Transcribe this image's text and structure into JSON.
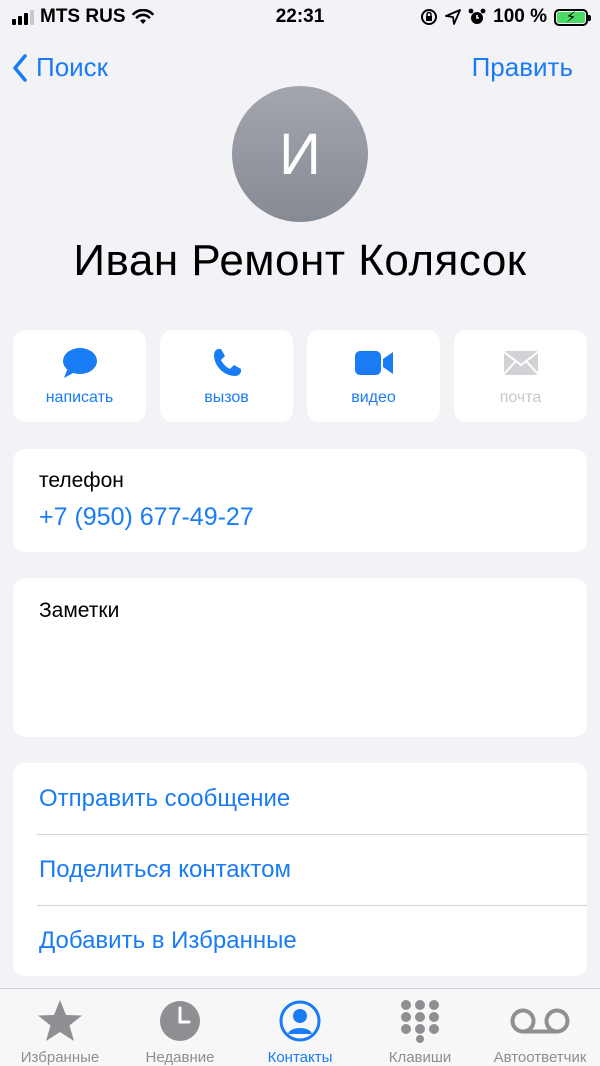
{
  "status_bar": {
    "carrier": "MTS RUS",
    "time": "22:31",
    "battery": "100 %",
    "battery_level": 1.0,
    "signal_bars": 4,
    "signal_bars_active": 3
  },
  "nav": {
    "back_label": "Поиск",
    "edit_label": "Править"
  },
  "contact": {
    "initial": "И",
    "name": "Иван Ремонт Колясок"
  },
  "actions": [
    {
      "label": "написать",
      "icon": "message-icon",
      "enabled": true
    },
    {
      "label": "вызов",
      "icon": "phone-icon",
      "enabled": true
    },
    {
      "label": "видео",
      "icon": "video-icon",
      "enabled": true
    },
    {
      "label": "почта",
      "icon": "mail-icon",
      "enabled": false
    }
  ],
  "phone": {
    "label": "телефон",
    "value": "+7 (950) 677-49-27"
  },
  "notes": {
    "label": "Заметки"
  },
  "links": [
    {
      "label": "Отправить сообщение"
    },
    {
      "label": "Поделиться контактом"
    },
    {
      "label": "Добавить в Избранные"
    }
  ],
  "tabbar": [
    {
      "label": "Избранные",
      "icon": "star-icon",
      "active": false
    },
    {
      "label": "Недавние",
      "icon": "clock-icon",
      "active": false
    },
    {
      "label": "Контакты",
      "icon": "person-icon",
      "active": true
    },
    {
      "label": "Клавиши",
      "icon": "keypad-icon",
      "active": false
    },
    {
      "label": "Автоответчик",
      "icon": "voicemail-icon",
      "active": false
    }
  ],
  "colors": {
    "accent": "#1a7cf5",
    "background": "#f2f2f7",
    "inactive": "#8e8e93",
    "disabled": "#c7c7cc",
    "battery_fill": "#4cd964"
  }
}
